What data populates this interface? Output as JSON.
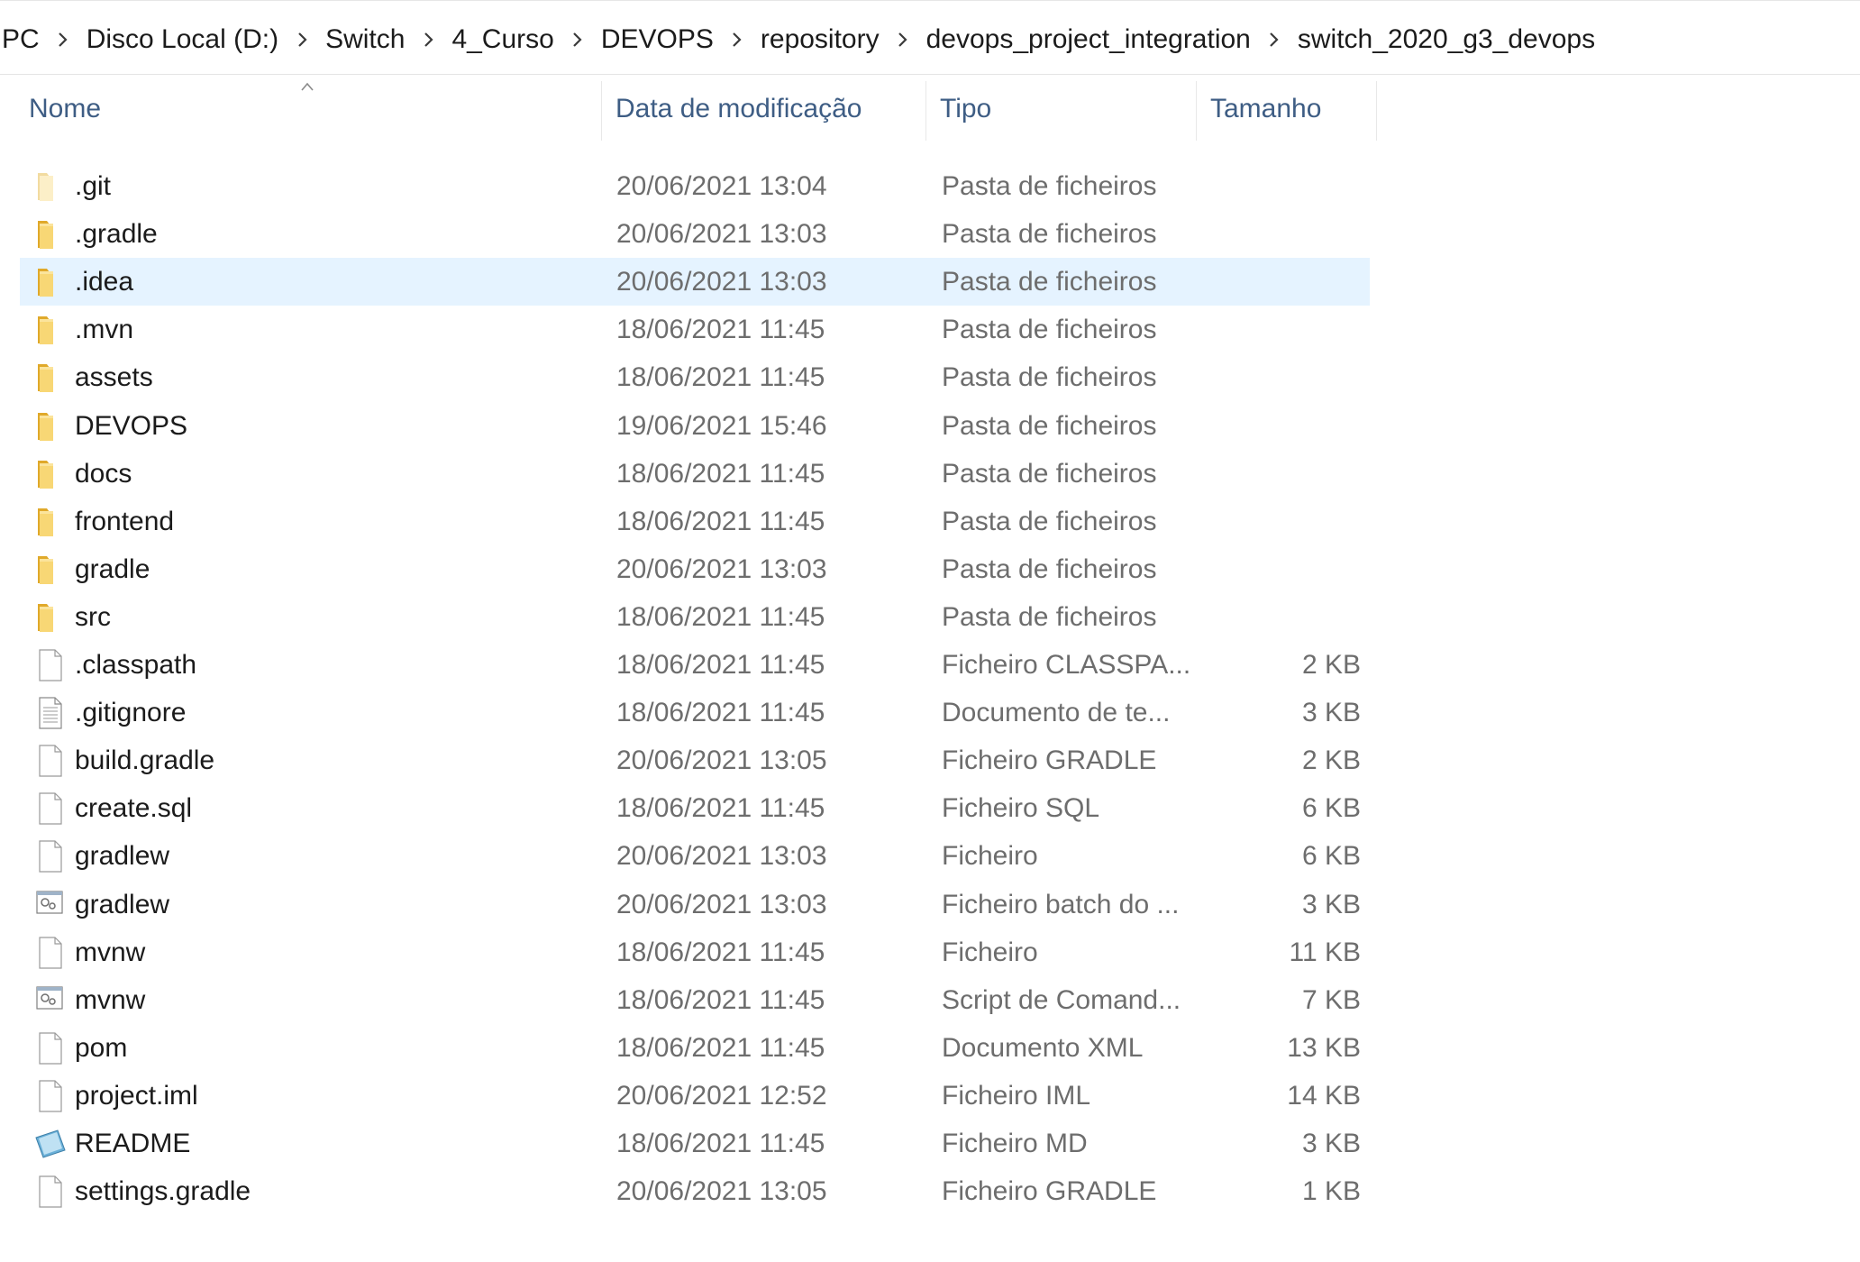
{
  "breadcrumb": [
    "PC",
    "Disco Local (D:)",
    "Switch",
    "4_Curso",
    "DEVOPS",
    "repository",
    "devops_project_integration",
    "switch_2020_g3_devops"
  ],
  "columns": {
    "name": "Nome",
    "date": "Data de modificação",
    "type": "Tipo",
    "size": "Tamanho"
  },
  "sort": {
    "column": "name",
    "direction": "ascending"
  },
  "selected_index": 2,
  "files": [
    {
      "name": ".git",
      "date": "20/06/2021 13:04",
      "type": "Pasta de ficheiros",
      "size": "",
      "icon": "folder-faded-icon"
    },
    {
      "name": ".gradle",
      "date": "20/06/2021 13:03",
      "type": "Pasta de ficheiros",
      "size": "",
      "icon": "folder-icon"
    },
    {
      "name": ".idea",
      "date": "20/06/2021 13:03",
      "type": "Pasta de ficheiros",
      "size": "",
      "icon": "folder-icon"
    },
    {
      "name": ".mvn",
      "date": "18/06/2021 11:45",
      "type": "Pasta de ficheiros",
      "size": "",
      "icon": "folder-icon"
    },
    {
      "name": "assets",
      "date": "18/06/2021 11:45",
      "type": "Pasta de ficheiros",
      "size": "",
      "icon": "folder-icon"
    },
    {
      "name": "DEVOPS",
      "date": "19/06/2021 15:46",
      "type": "Pasta de ficheiros",
      "size": "",
      "icon": "folder-icon"
    },
    {
      "name": "docs",
      "date": "18/06/2021 11:45",
      "type": "Pasta de ficheiros",
      "size": "",
      "icon": "folder-icon"
    },
    {
      "name": "frontend",
      "date": "18/06/2021 11:45",
      "type": "Pasta de ficheiros",
      "size": "",
      "icon": "folder-icon"
    },
    {
      "name": "gradle",
      "date": "20/06/2021 13:03",
      "type": "Pasta de ficheiros",
      "size": "",
      "icon": "folder-icon"
    },
    {
      "name": "src",
      "date": "18/06/2021 11:45",
      "type": "Pasta de ficheiros",
      "size": "",
      "icon": "folder-icon"
    },
    {
      "name": ".classpath",
      "date": "18/06/2021 11:45",
      "type": "Ficheiro CLASSPA...",
      "size": "2 KB",
      "icon": "file-icon"
    },
    {
      "name": ".gitignore",
      "date": "18/06/2021 11:45",
      "type": "Documento de te...",
      "size": "3 KB",
      "icon": "text-file-icon"
    },
    {
      "name": "build.gradle",
      "date": "20/06/2021 13:05",
      "type": "Ficheiro GRADLE",
      "size": "2 KB",
      "icon": "file-icon"
    },
    {
      "name": "create.sql",
      "date": "18/06/2021 11:45",
      "type": "Ficheiro SQL",
      "size": "6 KB",
      "icon": "file-icon"
    },
    {
      "name": "gradlew",
      "date": "20/06/2021 13:03",
      "type": "Ficheiro",
      "size": "6 KB",
      "icon": "file-icon"
    },
    {
      "name": "gradlew",
      "date": "20/06/2021 13:03",
      "type": "Ficheiro batch do ...",
      "size": "3 KB",
      "icon": "batch-file-icon"
    },
    {
      "name": "mvnw",
      "date": "18/06/2021 11:45",
      "type": "Ficheiro",
      "size": "11 KB",
      "icon": "file-icon"
    },
    {
      "name": "mvnw",
      "date": "18/06/2021 11:45",
      "type": "Script de Comand...",
      "size": "7 KB",
      "icon": "batch-file-icon"
    },
    {
      "name": "pom",
      "date": "18/06/2021 11:45",
      "type": "Documento XML",
      "size": "13 KB",
      "icon": "file-icon"
    },
    {
      "name": "project.iml",
      "date": "20/06/2021 12:52",
      "type": "Ficheiro IML",
      "size": "14 KB",
      "icon": "file-icon"
    },
    {
      "name": "README",
      "date": "18/06/2021 11:45",
      "type": "Ficheiro MD",
      "size": "3 KB",
      "icon": "markdown-file-icon"
    },
    {
      "name": "settings.gradle",
      "date": "20/06/2021 13:05",
      "type": "Ficheiro GRADLE",
      "size": "1 KB",
      "icon": "file-icon"
    }
  ],
  "colors": {
    "selection": "#e5f3ff",
    "header_text": "#3e5d84",
    "secondary_text": "#6d6d6d",
    "folder": "#f8d775"
  }
}
